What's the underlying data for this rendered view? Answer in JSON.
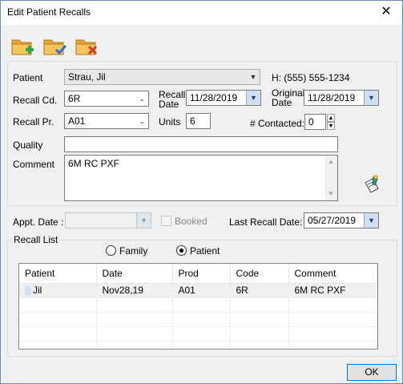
{
  "window": {
    "title": "Edit Patient Recalls",
    "close_glyph": "✕"
  },
  "toolbar": [
    {
      "name": "add-recall-icon",
      "accent": "#2fa84f"
    },
    {
      "name": "accept-recall-icon",
      "accent": "#2c6fd0"
    },
    {
      "name": "delete-recall-icon",
      "accent": "#d23a2a"
    }
  ],
  "form": {
    "patient_label": "Patient",
    "patient_value": "Strau, Jil",
    "phone": "H: (555) 555-1234",
    "recall_cd_label": "Recall Cd.",
    "recall_cd_value": "6R",
    "recall_date_label_1": "Recall",
    "recall_date_label_2": "Date",
    "recall_date_value": "11/28/2019",
    "original_date_label_1": "Original",
    "original_date_label_2": "Date",
    "original_date_value": "11/28/2019",
    "recall_pr_label": "Recall Pr.",
    "recall_pr_value": "A01",
    "units_label": "Units",
    "units_value": "6",
    "contacted_label": "# Contacted:",
    "contacted_value": "0",
    "quality_label": "Quality",
    "quality_value": "",
    "comment_label": "Comment",
    "comment_value": "6M RC PXF"
  },
  "appointment": {
    "appt_date_label": "Appt. Date :",
    "appt_date_value": "",
    "booked_label": "Booked",
    "last_recall_label": "Last Recall Date:",
    "last_recall_value": "05/27/2019"
  },
  "recall_list": {
    "title": "Recall List",
    "radio_family": "Family",
    "radio_patient": "Patient",
    "selected": "patient",
    "columns": [
      "Patient",
      "Date",
      "Prod",
      "Code",
      "Comment"
    ],
    "rows": [
      [
        "Jil",
        "Nov28,19",
        "A01",
        "6R",
        "6M RC PXF"
      ]
    ]
  },
  "buttons": {
    "ok": "OK"
  }
}
